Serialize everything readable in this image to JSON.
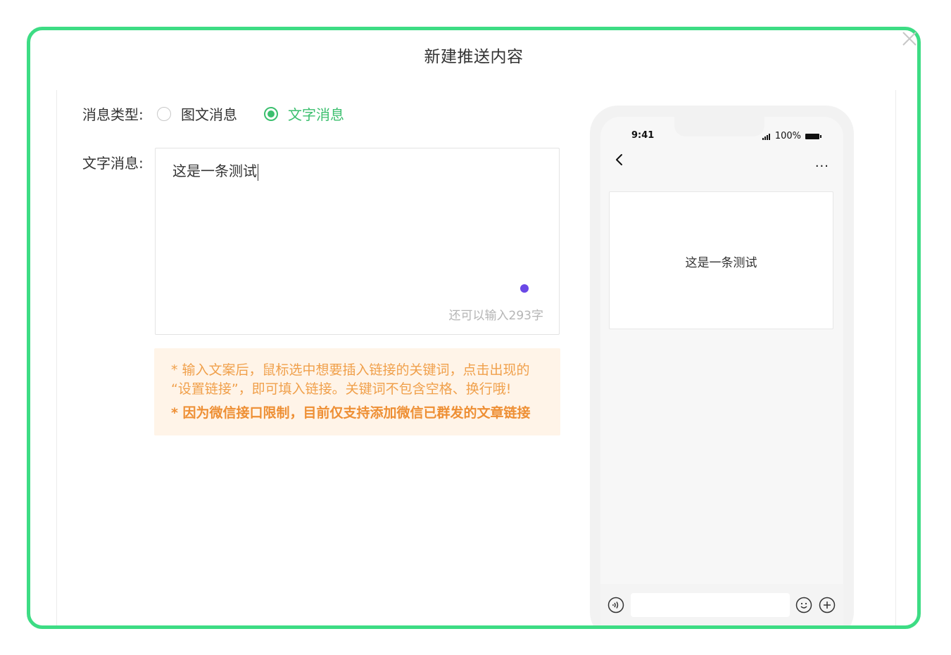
{
  "modal": {
    "title": "新建推送内容",
    "close_icon": "close-icon",
    "accent_color": "#3ddc84"
  },
  "form": {
    "message_type_label": "消息类型:",
    "options": [
      {
        "label": "图文消息",
        "checked": false
      },
      {
        "label": "文字消息",
        "checked": true
      }
    ],
    "text_label": "文字消息:",
    "text_value": "这是一条测试",
    "counter": "还可以输入293字"
  },
  "notice": {
    "line1": "* 输入文案后，鼠标选中想要插入链接的关键词，点击出现的",
    "line2": "“设置链接”，即可填入链接。关键词不包含空格、换行哦!",
    "line3": "* 因为微信接口限制，目前仅支持添加微信已群发的文章链接"
  },
  "preview": {
    "time": "9:41",
    "battery": "100%",
    "more": "···",
    "message": "这是一条测试",
    "icons": [
      "back-icon",
      "more-icon",
      "voice-icon",
      "emoji-icon",
      "plus-icon"
    ]
  }
}
